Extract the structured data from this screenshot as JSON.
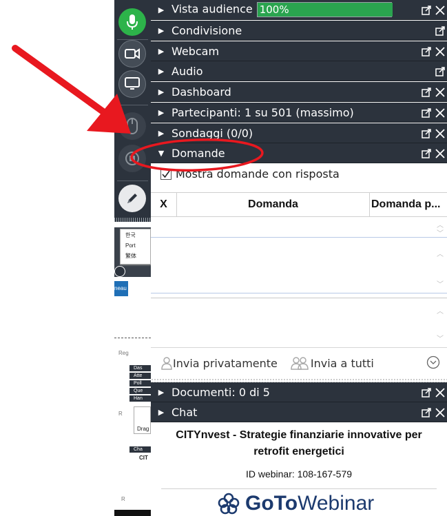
{
  "panel": {
    "headers": [
      {
        "label": "Vista audience",
        "expanded": false
      },
      {
        "label": "Condivisione",
        "expanded": false
      },
      {
        "label": "Webcam",
        "expanded": false
      },
      {
        "label": "Audio",
        "expanded": false
      },
      {
        "label": "Dashboard",
        "expanded": false
      },
      {
        "label": "Partecipanti:  1 su 501 (massimo)",
        "expanded": false
      },
      {
        "label": "Sondaggi (0/0)",
        "expanded": false
      },
      {
        "label": "Domande",
        "expanded": true
      },
      {
        "label": "Documenti: 0 di 5",
        "expanded": false
      },
      {
        "label": "Chat",
        "expanded": false
      }
    ],
    "audience_percent": 100,
    "audience_text": "100%",
    "questions": {
      "show_answered_label": "Mostra domande con risposta",
      "show_answered_checked": true,
      "columns": [
        "X",
        "Domanda",
        "Domanda p..."
      ],
      "send_private_label": "Invia privatamente",
      "send_all_label": "Invia a tutti"
    },
    "webinar": {
      "title": "CITYnvest - Strategie finanziarie innovative per retrofit energetici",
      "id_text": "ID webinar: 108-167-579",
      "logo_goto": "GoTo",
      "logo_webinar": "Webinar"
    }
  },
  "background_panel": {
    "menu_items": [
      "한국",
      "Port",
      "繁体"
    ],
    "tab_label": "neau",
    "reg_label": "Reg",
    "headers": [
      "Das",
      "Atte",
      "Poll",
      "Que",
      "Han",
      "Cha"
    ],
    "drag_label": "Drag",
    "r1": "R",
    "r2": "R",
    "cit": "CIT"
  },
  "colors": {
    "panel_header": "#2c333d",
    "mic_active": "#2db34a",
    "audience_fill": "#2aa44f",
    "annotation": "#e8181f"
  },
  "icons": [
    "microphone-icon",
    "webcam-icon",
    "screen-icon",
    "mouse-icon",
    "questions-icon",
    "pen-icon",
    "popout-icon",
    "close-icon"
  ]
}
